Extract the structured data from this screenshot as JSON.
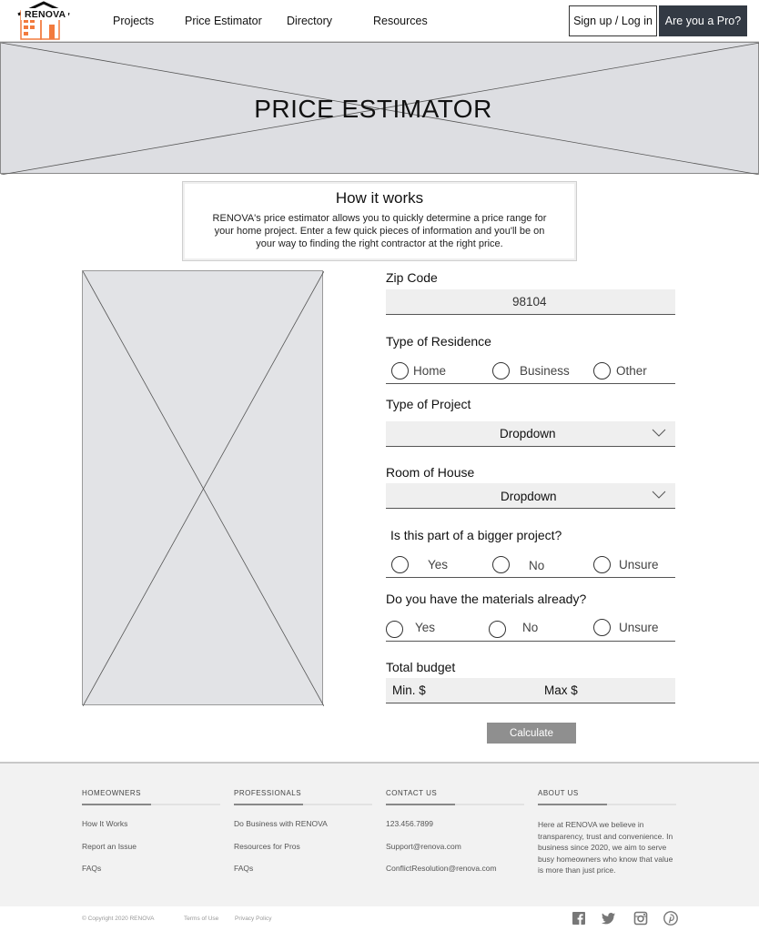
{
  "brand": {
    "name": "RENOVA",
    "accent": "#f27a3d"
  },
  "nav": {
    "items": [
      {
        "label": "Projects"
      },
      {
        "label": "Price Estimator"
      },
      {
        "label": "Directory"
      },
      {
        "label": "Resources"
      }
    ],
    "login_label": "Sign up / Log in",
    "pro_label": "Are you a Pro?"
  },
  "hero": {
    "title": "PRICE ESTIMATOR"
  },
  "how_it_works": {
    "title": "How it works",
    "text": "RENOVA's price estimator allows you to quickly determine a price range for your home project. Enter a few quick pieces of information and you'll be on your way to finding the right contractor at the right price."
  },
  "form": {
    "zip": {
      "label": "Zip Code",
      "value": "98104"
    },
    "residence": {
      "label": "Type of Residence",
      "options": [
        "Home",
        "Business",
        "Other"
      ]
    },
    "project": {
      "label": "Type of Project",
      "value": "Dropdown"
    },
    "room": {
      "label": "Room of House",
      "value": "Dropdown"
    },
    "bigger": {
      "label": "Is this part of a bigger project?",
      "options": [
        "Yes",
        "No",
        "Unsure"
      ]
    },
    "materials": {
      "label": "Do you have the materials already?",
      "options": [
        "Yes",
        "No",
        "Unsure"
      ]
    },
    "budget": {
      "label": "Total budget",
      "min_label": "Min. $",
      "max_label": "Max $"
    },
    "calculate_label": "Calculate"
  },
  "footer": {
    "homeowners": {
      "heading": "HOMEOWNERS",
      "links": [
        "How It Works",
        "Report an Issue",
        "FAQs"
      ]
    },
    "professionals": {
      "heading": "PROFESSIONALS",
      "links": [
        "Do Business with RENOVA",
        "Resources for Pros",
        "FAQs"
      ]
    },
    "contact": {
      "heading": "CONTACT US",
      "links": [
        "123.456.7899",
        "Support@renova.com",
        "ConflictResolution@renova.com"
      ]
    },
    "about": {
      "heading": "ABOUT US",
      "text": "Here at RENOVA we believe in transparency, trust and convenience. In business since 2020, we aim to serve busy homeowners who know that value is more than just price."
    }
  },
  "bottom": {
    "copyright": "© Copyright  2020  RENOVA",
    "terms": "Terms of Use",
    "privacy": "Privacy Policy",
    "social_icons": [
      "facebook-icon",
      "twitter-icon",
      "instagram-icon",
      "pinterest-icon"
    ]
  }
}
